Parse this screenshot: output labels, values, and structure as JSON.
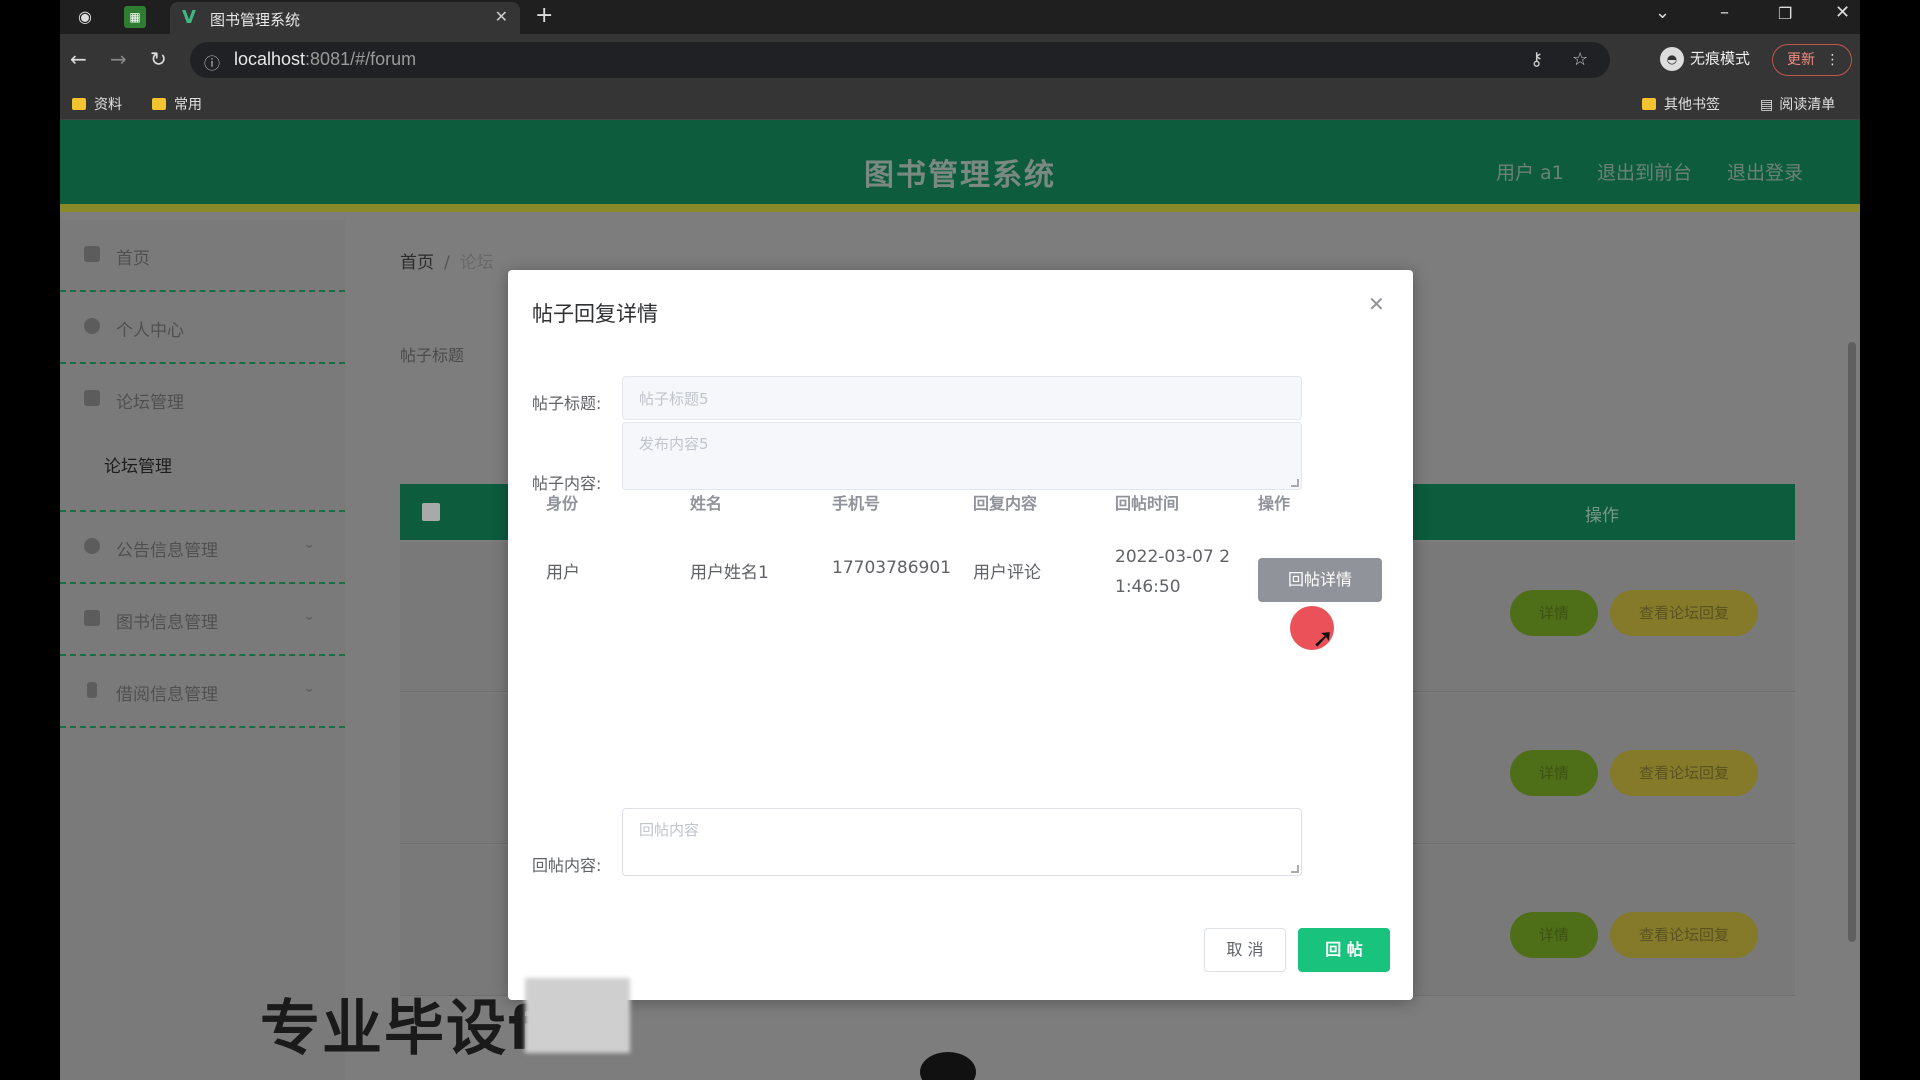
{
  "browser": {
    "tab_title": "图书管理系统",
    "url_host": "localhost",
    "url_rest": ":8081/#/forum",
    "incognito_label": "无痕模式",
    "update_label": "更新",
    "bookmarks": [
      "资料",
      "常用"
    ],
    "bookmarks_right": [
      "其他书签",
      "阅读清单"
    ]
  },
  "header": {
    "title": "图书管理系统",
    "links": [
      "用户 a1",
      "退出到前台",
      "退出登录"
    ]
  },
  "sidebar": {
    "items": [
      {
        "label": "首页",
        "icon": "home-icon"
      },
      {
        "label": "个人中心",
        "icon": "user-icon"
      },
      {
        "label": "论坛管理",
        "icon": "forum-icon"
      },
      {
        "label": "公告信息管理",
        "icon": "notice-icon"
      },
      {
        "label": "图书信息管理",
        "icon": "book-icon"
      },
      {
        "label": "借阅信息管理",
        "icon": "borrow-icon"
      }
    ],
    "subitem": "论坛管理"
  },
  "main": {
    "breadcrumb_home": "首页",
    "breadcrumb_current": "论坛",
    "search_label": "帖子标题",
    "op_header": "操作",
    "row_btn_edit": "详情",
    "row_btn_view": "查看论坛回复"
  },
  "dialog": {
    "title": "帖子回复详情",
    "label_title": "帖子标题:",
    "value_title": "帖子标题5",
    "label_content": "帖子内容:",
    "value_content": "发布内容5",
    "table_headers": [
      "身份",
      "姓名",
      "手机号",
      "回复内容",
      "回帖时间",
      "操作"
    ],
    "rows": [
      {
        "role": "用户",
        "name": "用户姓名1",
        "phone": "17703786901",
        "content": "用户评论",
        "time": "2022-03-07 21:46:50",
        "action": "回帖详情"
      }
    ],
    "label_reply": "回帖内容:",
    "placeholder_reply": "回帖内容",
    "cancel_label": "取 消",
    "submit_label": "回 帖"
  },
  "overlay": {
    "watermark_text": "专业毕设f"
  }
}
